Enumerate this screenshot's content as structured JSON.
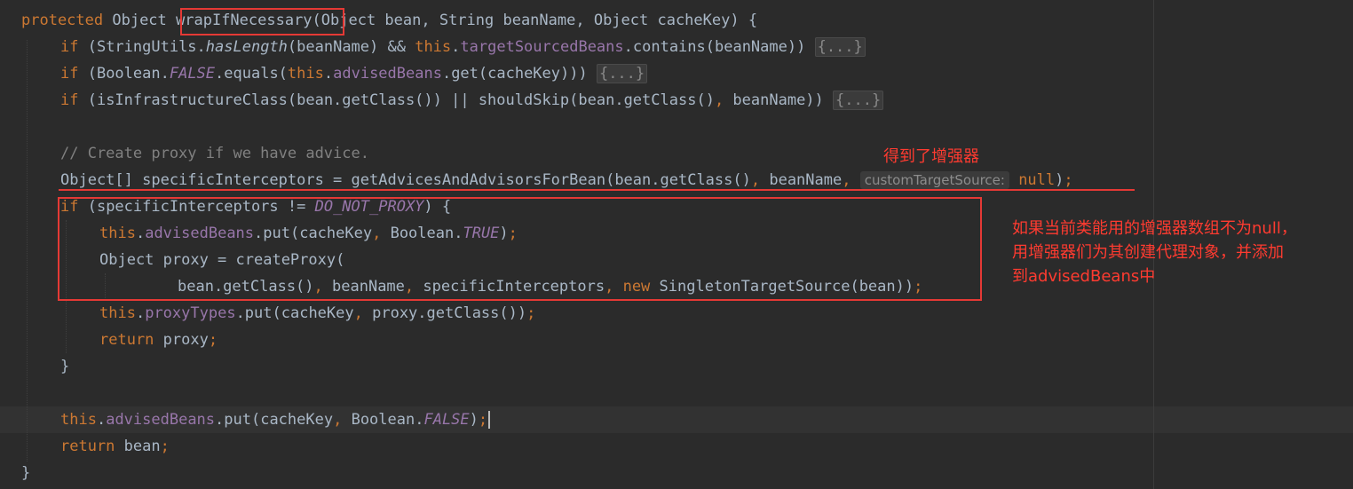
{
  "editor": {
    "lines": [
      [
        {
          "t": "protected ",
          "c": "kw"
        },
        {
          "t": "Object "
        },
        {
          "t": "wrapIfNecessary"
        },
        {
          "t": "(Object bean, String beanName, Object cacheKey) {"
        }
      ],
      [
        {
          "t": "if ",
          "c": "kw"
        },
        {
          "t": "(StringUtils."
        },
        {
          "t": "hasLength",
          "c": "italfn"
        },
        {
          "t": "(beanName) && "
        },
        {
          "t": "this",
          "c": "kw"
        },
        {
          "t": "."
        },
        {
          "t": "targetSourcedBeans",
          "c": "fld"
        },
        {
          "t": ".contains(beanName)) "
        },
        {
          "t": "{...}",
          "c": "fold"
        }
      ],
      [
        {
          "t": "if ",
          "c": "kw"
        },
        {
          "t": "(Boolean."
        },
        {
          "t": "FALSE",
          "c": "ital"
        },
        {
          "t": ".equals("
        },
        {
          "t": "this",
          "c": "kw"
        },
        {
          "t": "."
        },
        {
          "t": "advisedBeans",
          "c": "fld"
        },
        {
          "t": ".get(cacheKey))) "
        },
        {
          "t": "{...}",
          "c": "fold"
        }
      ],
      [
        {
          "t": "if ",
          "c": "kw"
        },
        {
          "t": "(isInfrastructureClass(bean.getClass()) || shouldSkip(bean.getClass()"
        },
        {
          "t": ", ",
          "c": "kw"
        },
        {
          "t": "beanName)) "
        },
        {
          "t": "{...}",
          "c": "fold"
        }
      ],
      [],
      [
        {
          "t": "// Create proxy if we have advice.",
          "c": "cmt"
        }
      ],
      [
        {
          "t": "Object[] specificInterceptors = getAdvicesAndAdvisorsForBean(bean.getClass()"
        },
        {
          "t": ", ",
          "c": "kw"
        },
        {
          "t": "beanName"
        },
        {
          "t": ", ",
          "c": "kw"
        },
        {
          "t": "customTargetSource:",
          "c": "hint"
        },
        {
          "t": " "
        },
        {
          "t": "null",
          "c": "kw"
        },
        {
          "t": ")"
        },
        {
          "t": ";",
          "c": "kw"
        }
      ],
      [
        {
          "t": "if ",
          "c": "kw"
        },
        {
          "t": "(specificInterceptors != "
        },
        {
          "t": "DO_NOT_PROXY",
          "c": "ital"
        },
        {
          "t": ") {"
        }
      ],
      [
        {
          "t": "this",
          "c": "kw"
        },
        {
          "t": "."
        },
        {
          "t": "advisedBeans",
          "c": "fld"
        },
        {
          "t": ".put(cacheKey"
        },
        {
          "t": ", ",
          "c": "kw"
        },
        {
          "t": "Boolean."
        },
        {
          "t": "TRUE",
          "c": "ital"
        },
        {
          "t": ")"
        },
        {
          "t": ";",
          "c": "kw"
        }
      ],
      [
        {
          "t": "Object proxy = createProxy("
        }
      ],
      [
        {
          "t": "bean.getClass()"
        },
        {
          "t": ", ",
          "c": "kw"
        },
        {
          "t": "beanName"
        },
        {
          "t": ", ",
          "c": "kw"
        },
        {
          "t": "specificInterceptors"
        },
        {
          "t": ", ",
          "c": "kw"
        },
        {
          "t": "new ",
          "c": "kw"
        },
        {
          "t": "SingletonTargetSource(bean))"
        },
        {
          "t": ";",
          "c": "kw"
        }
      ],
      [
        {
          "t": "this",
          "c": "kw"
        },
        {
          "t": "."
        },
        {
          "t": "proxyTypes",
          "c": "fld"
        },
        {
          "t": ".put(cacheKey"
        },
        {
          "t": ", ",
          "c": "kw"
        },
        {
          "t": "proxy.getClass())"
        },
        {
          "t": ";",
          "c": "kw"
        }
      ],
      [
        {
          "t": "return ",
          "c": "kw"
        },
        {
          "t": "proxy"
        },
        {
          "t": ";",
          "c": "kw"
        }
      ],
      [
        {
          "t": "}"
        }
      ],
      [],
      [
        {
          "t": "this",
          "c": "kw"
        },
        {
          "t": "."
        },
        {
          "t": "advisedBeans",
          "c": "fld"
        },
        {
          "t": ".put(cacheKey"
        },
        {
          "t": ", ",
          "c": "kw"
        },
        {
          "t": "Boolean."
        },
        {
          "t": "FALSE",
          "c": "ital"
        },
        {
          "t": ")"
        },
        {
          "t": ";",
          "c": "kw"
        }
      ],
      [
        {
          "t": "return ",
          "c": "kw"
        },
        {
          "t": "bean"
        },
        {
          "t": ";",
          "c": "kw"
        }
      ],
      [
        {
          "t": "}"
        }
      ]
    ]
  },
  "annotations": {
    "top_note": "得到了增强器",
    "side_note_lines": [
      "如果当前类能用的增强器数组不为null，",
      "用增强器们为其创建代理对象，并添加",
      "到advisedBeans中"
    ]
  },
  "colors": {
    "background": "#2b2b2b",
    "keyword": "#cc7832",
    "field": "#9876aa",
    "comment": "#808080",
    "text": "#a9b7c6",
    "annotation": "#e53935"
  }
}
